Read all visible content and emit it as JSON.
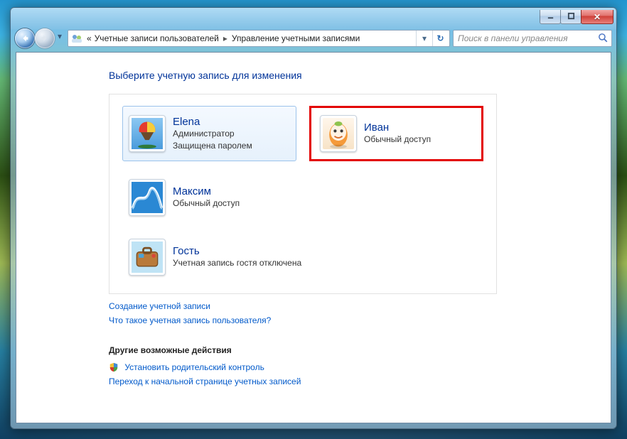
{
  "titlebar": {
    "minimize_tip": "Свернуть",
    "maximize_tip": "Развернуть",
    "close_tip": "Закрыть"
  },
  "nav": {
    "back_tip": "Назад",
    "forward_tip": "Вперёд"
  },
  "breadcrumb": {
    "level1_prefix": "«",
    "level1": "Учетные записи пользователей",
    "level2": "Управление учетными записями"
  },
  "search": {
    "placeholder": "Поиск в панели управления"
  },
  "heading": "Выберите учетную запись для изменения",
  "accounts": [
    {
      "name": "Elena",
      "line1": "Администратор",
      "line2": "Защищена паролем",
      "selected": true,
      "avatar": "balloon"
    },
    {
      "name": "Иван",
      "line1": "Обычный доступ",
      "line2": "",
      "selected": false,
      "avatar": "egg",
      "highlighted": true
    },
    {
      "name": "Максим",
      "line1": "Обычный доступ",
      "line2": "",
      "selected": false,
      "avatar": "coaster"
    },
    {
      "name": "Гость",
      "line1": "Учетная запись гостя отключена",
      "line2": "",
      "selected": false,
      "avatar": "suitcase"
    }
  ],
  "links": {
    "create": "Создание учетной записи",
    "whatis": "Что такое учетная запись пользователя?"
  },
  "actions": {
    "heading": "Другие возможные действия",
    "parental": "Установить родительский контроль",
    "gohome": "Переход к начальной странице учетных записей"
  }
}
